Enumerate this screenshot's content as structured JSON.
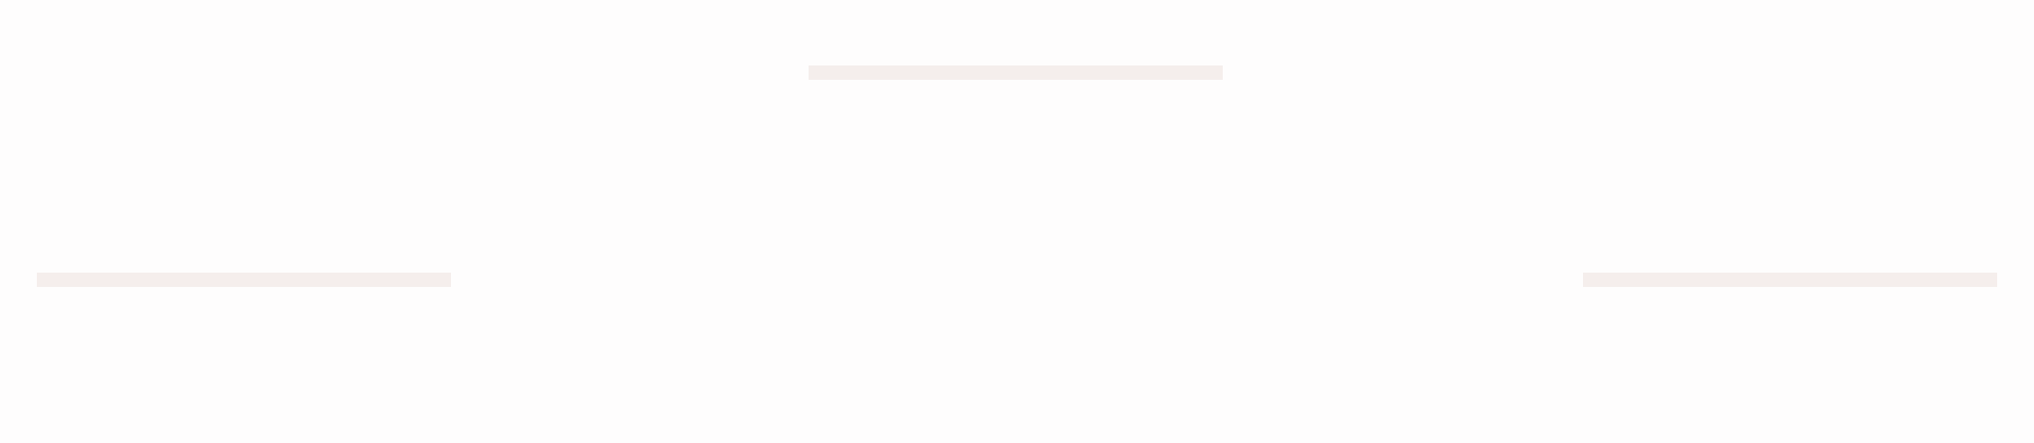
{
  "colors": {
    "background": "#fefdfd",
    "placeholder_bar": "#f5eeec"
  },
  "placeholders": {
    "count": 3,
    "items": [
      {
        "name": "top-center"
      },
      {
        "name": "bottom-left"
      },
      {
        "name": "bottom-right"
      }
    ]
  }
}
